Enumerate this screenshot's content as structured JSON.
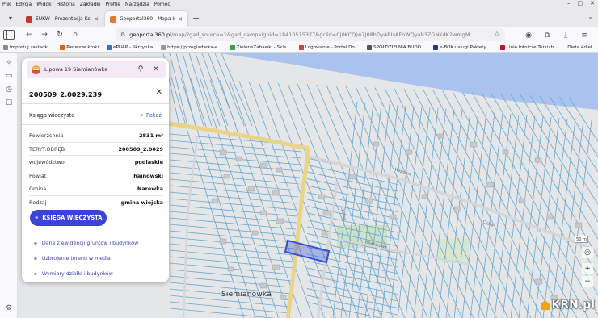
{
  "menubar": {
    "items": [
      "Plik",
      "Edycja",
      "Widok",
      "Historia",
      "Zakładki",
      "Profile",
      "Narzędzia",
      "Pomoc"
    ]
  },
  "tabs": [
    {
      "title": "EUKW - Prezentacja Księgi Wie",
      "favicon_color": "#c0392b",
      "active": false
    },
    {
      "title": "Geoportal360 - Mapa Interakty",
      "favicon_color": "#e07b2a",
      "active": true
    }
  ],
  "urlbar": {
    "host": "geoportal360.pl",
    "path": "/map/?gad_source=1&gad_campaignid=18410515377&gclid=Cj0KCQjw7J08hDyARIsAFnWQyab3ZGNKdK2wmgMwgetvW0"
  },
  "bookmarks": [
    {
      "label": "Importuj zakładk...",
      "color": "#888888"
    },
    {
      "label": "Pierwsze kroki",
      "color": "#e66000"
    },
    {
      "label": "ePUAP - Skrzynka",
      "color": "#2e6fd8"
    },
    {
      "label": "https://przegladarka-e...",
      "color": "#999999"
    },
    {
      "label": "ZieloneZabawki - Skle...",
      "color": "#3aa34a"
    },
    {
      "label": "Logowanie - Portal Do...",
      "color": "#d43d3d"
    },
    {
      "label": "SPÓŁDZIELNIA BUDO...",
      "color": "#555555"
    },
    {
      "label": "e-BOK usługi Pakiety ...",
      "color": "#1d3b8f"
    },
    {
      "label": "Linie lotnicze Turkish ...",
      "color": "#c8102e"
    },
    {
      "label": "Dieta 4diet",
      "color": "#777777"
    }
  ],
  "panel": {
    "search_text": "Lipowa 19 Siemianówka",
    "parcel_id": "200509_2.0029.239",
    "kw_label": "Księga wieczysta",
    "kw_show": "Pokaż",
    "attributes": [
      {
        "key": "Powierzchnia",
        "value": "2831 m²"
      },
      {
        "key": "TERYT.OBRĘB",
        "value": "200509_2.0029"
      },
      {
        "key": "województwo",
        "value": "podlaskie"
      },
      {
        "key": "Powiat",
        "value": "hajnowski"
      },
      {
        "key": "Gmina",
        "value": "Narewka"
      },
      {
        "key": "Rodzaj",
        "value": "gmina wiejska"
      }
    ],
    "kw_button": "KSIĘGA WIECZYSTA",
    "links": [
      "Dane z ewidencji gruntów i budynków",
      "Uzbrojenie terenu w media",
      "Wymiary działki i budynków"
    ]
  },
  "map": {
    "town_label": "Siemianówka",
    "scale_text": "50 m",
    "street_labels": [
      "Lipowa",
      "Spacerowa",
      "Wspólna",
      "Cicha"
    ],
    "water_color": "#a9c3ee",
    "road_color": "#e9d488",
    "parcel_line_color": "#6aa7cf",
    "highlight_color": "#3a4fd4"
  },
  "watermark": "KRN.pl"
}
